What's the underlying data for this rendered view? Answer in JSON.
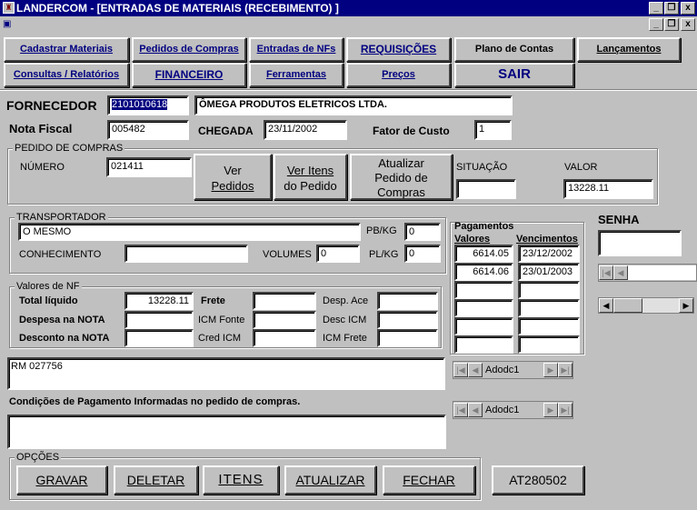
{
  "window": {
    "title": "LANDERCOM - [ENTRADAS DE  MATERIAIS (RECEBIMENTO) ]",
    "minimize": "_",
    "restore": "❐",
    "close": "x"
  },
  "nav": {
    "row1": [
      "Cadastrar Materiais",
      "Pedidos de Compras",
      "Entradas de NFs",
      "REQUISIÇÕES",
      "Plano de Contas",
      "Lançamentos"
    ],
    "row2": [
      "Consultas / Relatórios",
      "FINANCEIRO",
      "Ferramentas",
      "Preços",
      "SAIR"
    ]
  },
  "fornecedor": {
    "label": "FORNECEDOR",
    "code": "2101010618",
    "name": "ÔMEGA PRODUTOS ELETRICOS LTDA."
  },
  "nota": {
    "label": "Nota Fiscal",
    "value": "005482",
    "chegada_label": "CHEGADA",
    "chegada_value": "23/11/2002",
    "fator_label": "Fator de Custo",
    "fator_value": "1"
  },
  "pedido": {
    "group_title": "PEDIDO DE COMPRAS",
    "numero_label": "NÚMERO",
    "numero_value": "021411",
    "btn_ver_pedidos": [
      "Ver",
      "Pedidos"
    ],
    "btn_ver_itens": [
      "Ver Itens",
      "do Pedido"
    ],
    "btn_atualizar": [
      "Atualizar",
      "Pedido de",
      "Compras"
    ],
    "situacao_label": "SITUAÇÃO",
    "situacao_value": "",
    "valor_label": "VALOR",
    "valor_value": "13228.11"
  },
  "transportador": {
    "group_title": "TRANSPORTADOR",
    "value": "O MESMO",
    "pbkg_label": "PB/KG",
    "pbkg_value": "0",
    "conhecimento_label": "CONHECIMENTO",
    "conhecimento_value": "",
    "volumes_label": "VOLUMES",
    "volumes_value": "0",
    "plkg_label": "PL/KG",
    "plkg_value": "0"
  },
  "pagamentos": {
    "title": "Pagamentos",
    "valores_label": "Valores",
    "vencimentos_label": "Vencimentos",
    "rows": [
      {
        "valor": "6614.05",
        "vencimento": "23/12/2002"
      },
      {
        "valor": "6614.06",
        "vencimento": "23/01/2003"
      },
      {
        "valor": "",
        "vencimento": ""
      },
      {
        "valor": "",
        "vencimento": ""
      },
      {
        "valor": "",
        "vencimento": ""
      },
      {
        "valor": "",
        "vencimento": ""
      }
    ]
  },
  "senha": {
    "label": "SENHA",
    "value": ""
  },
  "valores_nf": {
    "group_title": "Valores de NF",
    "total_label": "Total líquido",
    "total_value": "13228.11",
    "despesa_label": "Despesa na NOTA",
    "despesa_value": "",
    "desconto_label": "Desconto na NOTA",
    "desconto_value": "",
    "frete_label": "Frete",
    "frete_value": "",
    "icm_fonte_label": "ICM Fonte",
    "icm_fonte_value": "",
    "cred_icm_label": "Cred ICM",
    "cred_icm_value": "",
    "desp_ace_label": "Desp. Ace",
    "desp_ace_value": "",
    "desc_icm_label": "Desc ICM",
    "desc_icm_value": "",
    "icm_frete_label": "ICM Frete",
    "icm_frete_value": ""
  },
  "memo1": "RM 027756",
  "adodc1": "Adodc1",
  "adodc2": "Adodc1",
  "condicoes": {
    "label": "Condições de Pagamento Informadas no pedido de compras.",
    "value": ""
  },
  "opcoes": {
    "group_title": "OPÇÕES",
    "gravar": "GRAVAR",
    "deletar": "DELETAR",
    "itens": "ITENS",
    "atualizar": "ATUALIZAR",
    "fechar": "FECHAR",
    "version": "AT280502"
  }
}
